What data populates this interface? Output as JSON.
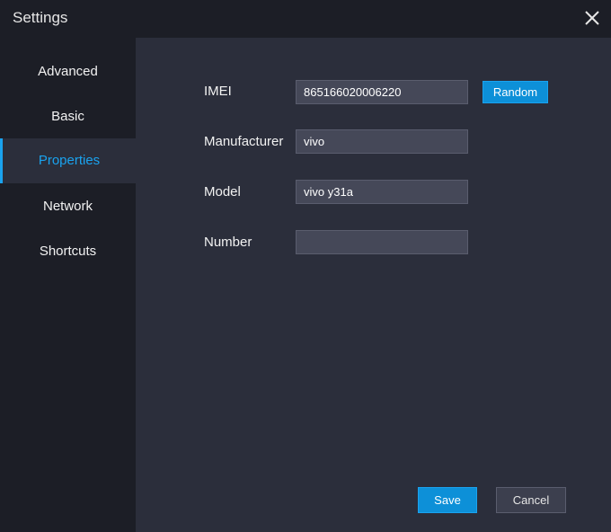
{
  "window": {
    "title": "Settings",
    "close_icon": "close-icon"
  },
  "sidebar": {
    "items": [
      {
        "label": "Advanced",
        "active": false
      },
      {
        "label": "Basic",
        "active": false
      },
      {
        "label": "Properties",
        "active": true
      },
      {
        "label": "Network",
        "active": false
      },
      {
        "label": "Shortcuts",
        "active": false
      }
    ]
  },
  "properties": {
    "imei": {
      "label": "IMEI",
      "value": "865166020006220"
    },
    "random_button": "Random",
    "manufacturer": {
      "label": "Manufacturer",
      "value": "vivo"
    },
    "model": {
      "label": "Model",
      "value": "vivo y31a"
    },
    "number": {
      "label": "Number",
      "value": ""
    }
  },
  "footer": {
    "save_label": "Save",
    "cancel_label": "Cancel"
  },
  "colors": {
    "accent": "#1aa3ef",
    "background": "#1c1e26",
    "panel": "#2b2e3b",
    "input": "#454858"
  }
}
